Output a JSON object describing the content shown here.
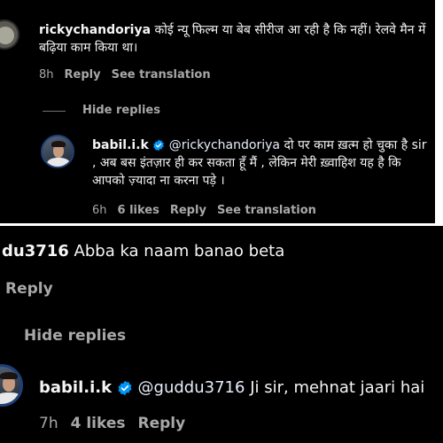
{
  "top_thread": {
    "comment": {
      "username": "rickychandoriya",
      "text": "कोई न्यू फिल्म या बेब सीरीज आ रही है कि नहीं। रेलवे मैन में बढ़िया काम किया था।",
      "time": "8h",
      "reply_label": "Reply",
      "translate_label": "See translation"
    },
    "hide_replies_label": "Hide replies",
    "reply": {
      "username": "babil.i.k",
      "verified": true,
      "mention": "@rickychandoriya",
      "text": "दो पर काम ख़त्म हो चुका है sir , अब बस इंतज़ार ही कर सकता हूँ मैं , लेकिन मेरी ख़्वाहिश यह है कि आपको ज़्यादा ना करना पड़े ।",
      "time": "6h",
      "likes": "6 likes",
      "reply_label": "Reply",
      "translate_label": "See translation"
    }
  },
  "bottom_thread": {
    "comment": {
      "username": "du3716",
      "text": "Abba ka naam banao beta",
      "reply_label": "Reply"
    },
    "hide_replies_label": "Hide replies",
    "reply": {
      "username": "babil.i.k",
      "verified": true,
      "mention": "@guddu3716",
      "text": "Ji sir, mehnat jaari hai",
      "time": "7h",
      "likes": "4 likes",
      "reply_label": "Reply"
    }
  },
  "colors": {
    "background": "#000000",
    "text": "#f5f5f5",
    "secondary_text": "#a8a8a8",
    "verified_badge": "#0095f6"
  }
}
